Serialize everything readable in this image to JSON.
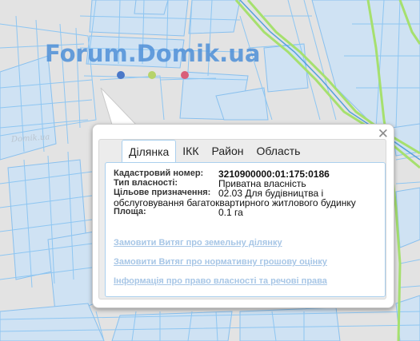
{
  "watermark": {
    "text": "Forum.Domik.ua",
    "dot_colors": [
      "#4a78c8",
      "#b6d36a",
      "#d95f7a"
    ],
    "small_text": "Domik.ua"
  },
  "popup": {
    "close_label": "✕",
    "tabs": [
      {
        "label": "Ділянка",
        "active": true
      },
      {
        "label": "ІКК",
        "active": false
      },
      {
        "label": "Район",
        "active": false
      },
      {
        "label": "Область",
        "active": false
      }
    ],
    "fields": {
      "cadastral_label": "Кадастровий номер:",
      "cadastral_value": "3210900000:01:175:0186",
      "ownership_label": "Тип власності:",
      "ownership_value": "Приватна власність",
      "purpose_label": "Цільове призначення:",
      "purpose_value_1": "02.03 Для будівництва і",
      "purpose_value_2": "обслуговування багатоквартирного житлового будинку",
      "area_label": "Площа:",
      "area_value": "0.1 га"
    },
    "links": {
      "extract_land": "Замовити Витяг про земельну ділянку",
      "extract_valuation": "Замовити Витяг про нормативну грошову оцінку",
      "ownership_info": "Інформація про право власності та речові права"
    }
  }
}
